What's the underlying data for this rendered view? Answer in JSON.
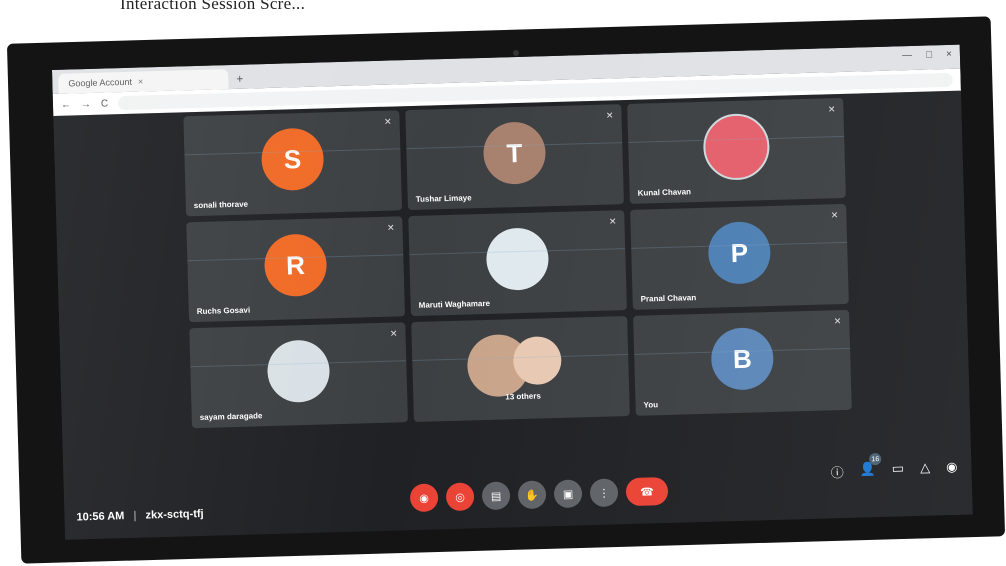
{
  "paper": {
    "caption": "Interaction Session Scre..."
  },
  "browser": {
    "tab_title": "Google Account",
    "tab_close": "×",
    "new_tab": "+",
    "window_controls": [
      "—",
      "□",
      "×"
    ],
    "nav": {
      "back": "←",
      "forward": "→",
      "reload": "C"
    }
  },
  "participants": [
    {
      "name": "sonali thorave",
      "initial": "S",
      "color": "#f06a26"
    },
    {
      "name": "Tushar Limaye",
      "initial": "T",
      "color": "#a8806e"
    },
    {
      "name": "Kunal Chavan",
      "initial": "",
      "color": "#e35f6b"
    },
    {
      "name": "Ruchs Gosavi",
      "initial": "R",
      "color": "#f06a26"
    },
    {
      "name": "Maruti Waghamare",
      "initial": "",
      "color": "#9fb7c8"
    },
    {
      "name": "Pranal Chavan",
      "initial": "P",
      "color": "#4c7fb3"
    },
    {
      "name": "sayam daragade",
      "initial": "",
      "color": "#d9e1e6"
    },
    {
      "name": "13 others",
      "initial": "",
      "color": "#c9a48a"
    },
    {
      "name": "You",
      "initial": "B",
      "color": "#5a86b8"
    }
  ],
  "mic_icon": "✕",
  "meeting": {
    "time": "10:56 AM",
    "separator": "|",
    "code": "zkx-sctq-tfj"
  },
  "controls": {
    "mic": "◉",
    "camera": "◎",
    "captions": "▤",
    "raise_hand": "✋",
    "present": "▣",
    "more": "⋮",
    "hangup": "☎"
  },
  "right": {
    "info": "ⓘ",
    "people": "👤",
    "people_count": "16",
    "chat": "▭",
    "activities": "△",
    "lock": "◉"
  }
}
